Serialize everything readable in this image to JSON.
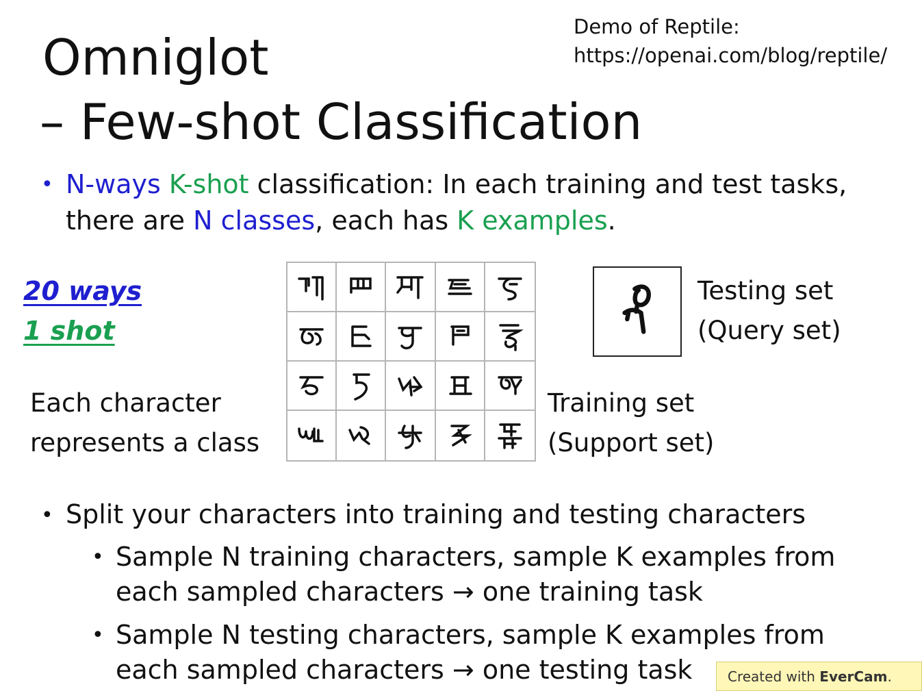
{
  "title": {
    "line1": "Omniglot",
    "line2": "– Few-shot Classification"
  },
  "demo": {
    "label": "Demo of Reptile:",
    "url": "https://openai.com/blog/reptile/"
  },
  "definition": {
    "line1_part1": "N-ways",
    "line1_part2": "K-shot",
    "line1_part3": " classification: In each training and test tasks,",
    "line2_part1": "there are ",
    "line2_part2": "N classes",
    "line2_part3": ", each has ",
    "line2_part4": "K examples",
    "line2_part5": "."
  },
  "setting": {
    "ways": "20 ways",
    "shots": "1 shot"
  },
  "caption_left": {
    "line1": "Each character",
    "line2": "represents a class"
  },
  "testing_label": {
    "line1": "Testing set",
    "line2": "(Query set)"
  },
  "training_label": {
    "line1": "Training set",
    "line2": "(Support set)"
  },
  "split": {
    "main": "Split your characters into training and testing characters",
    "sub1_line1": "Sample N training characters, sample K examples from",
    "sub1_line2": "each sampled characters  → one training task",
    "sub2_line1": "Sample N testing characters, sample K examples from",
    "sub2_line2": "each sampled characters  → one testing task"
  },
  "watermark": {
    "prefix": "Created with ",
    "brand": "EverCam",
    "suffix": "."
  },
  "colors": {
    "blue": "#1f1fd0",
    "green": "#1aa050"
  }
}
